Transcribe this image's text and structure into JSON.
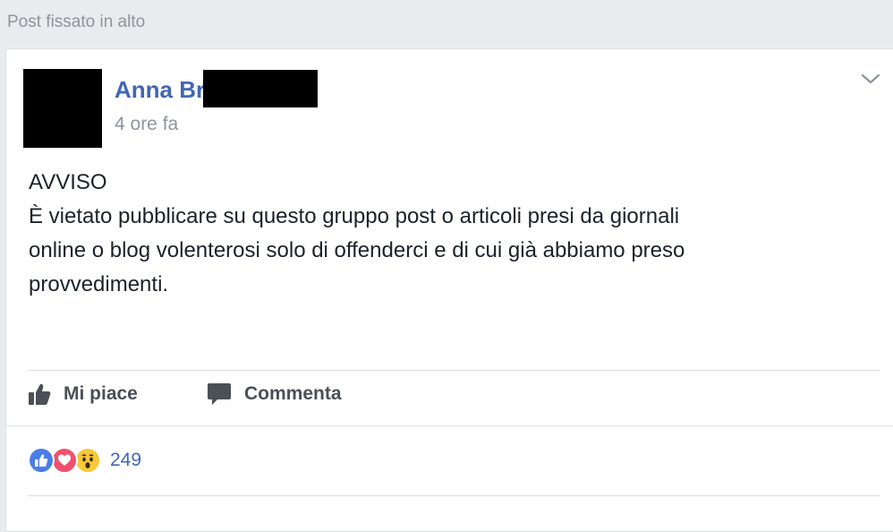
{
  "pinned": {
    "label": "Post fissato in alto"
  },
  "post": {
    "author": "Anna Br",
    "timestamp": "4 ore fa",
    "body_lines": [
      "AVVISO",
      "È vietato pubblicare su questo gruppo post o articoli presi da giornali",
      "online o blog volenterosi solo di offenderci e di cui già abbiamo preso",
      "provvedimenti."
    ]
  },
  "actions": {
    "like_label": "Mi piace",
    "comment_label": "Commenta"
  },
  "reactions": {
    "icons": [
      "like-icon",
      "love-icon",
      "wow-icon"
    ],
    "count": "249"
  },
  "colors": {
    "link": "#4267b2",
    "muted": "#90949c",
    "text": "#1d2129",
    "like": "#4a7ee6",
    "love": "#f0506e",
    "wow": "#f7c93a"
  }
}
